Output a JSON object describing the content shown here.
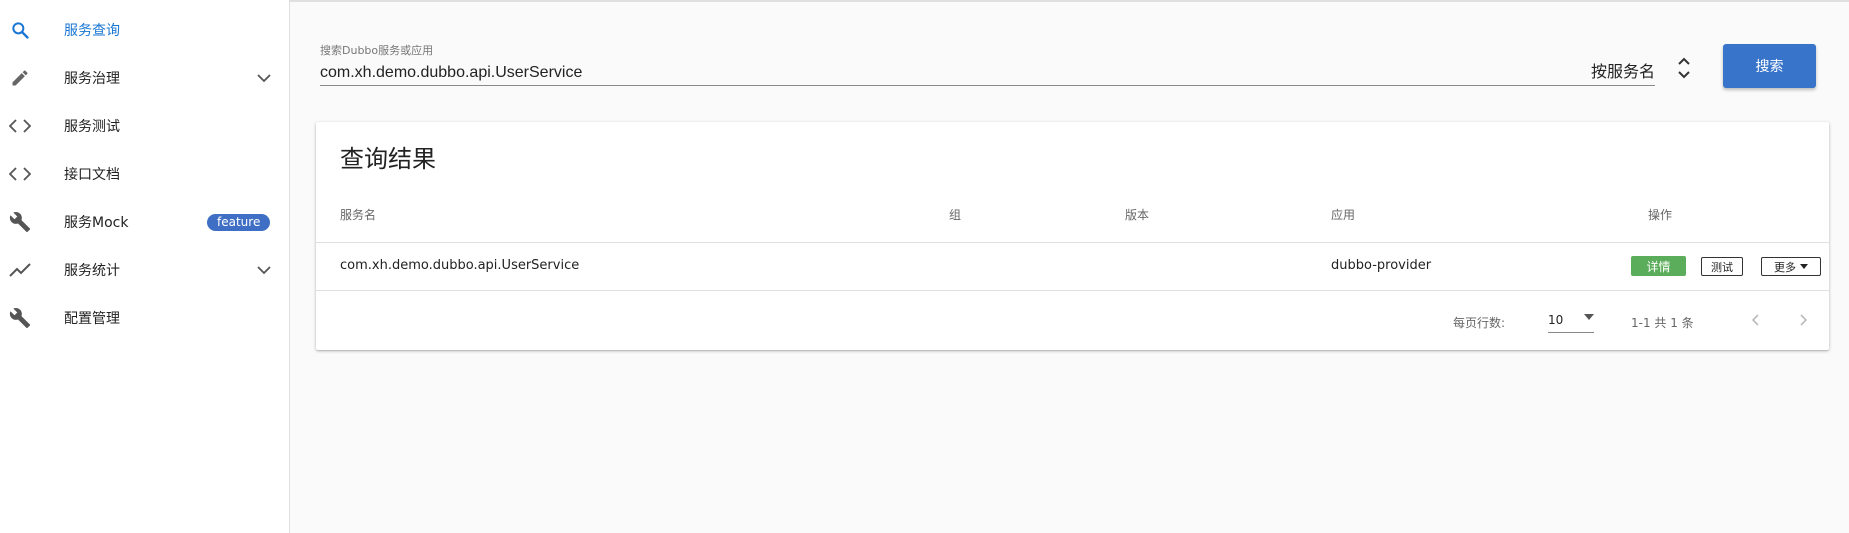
{
  "sidebar": {
    "items": [
      {
        "label": "服务查询",
        "icon": "search-icon"
      },
      {
        "label": "服务治理",
        "icon": "pencil-icon"
      },
      {
        "label": "服务测试",
        "icon": "code-icon"
      },
      {
        "label": "接口文档",
        "icon": "code-icon"
      },
      {
        "label": "服务Mock",
        "icon": "wrench-icon",
        "badge": "feature"
      },
      {
        "label": "服务统计",
        "icon": "trending-icon"
      },
      {
        "label": "配置管理",
        "icon": "wrench-icon"
      }
    ]
  },
  "search": {
    "label": "搜索Dubbo服务或应用",
    "value": "com.xh.demo.dubbo.api.UserService",
    "mode": "按服务名",
    "button": "搜索"
  },
  "results": {
    "title": "查询结果",
    "columns": [
      "服务名",
      "组",
      "版本",
      "应用",
      "操作"
    ],
    "rows": [
      {
        "service": "com.xh.demo.dubbo.api.UserService",
        "group": "",
        "version": "",
        "app": "dubbo-provider",
        "actions": {
          "detail": "详情",
          "test": "测试",
          "more": "更多"
        }
      }
    ],
    "footer": {
      "rows_per_page_label": "每页行数:",
      "rows_per_page": "10",
      "range": "1-1 共 1 条"
    }
  },
  "colors": {
    "accent": "#3874c9",
    "active": "#1976d2",
    "success": "#5cad5b",
    "badge": "#3f6fc4"
  }
}
